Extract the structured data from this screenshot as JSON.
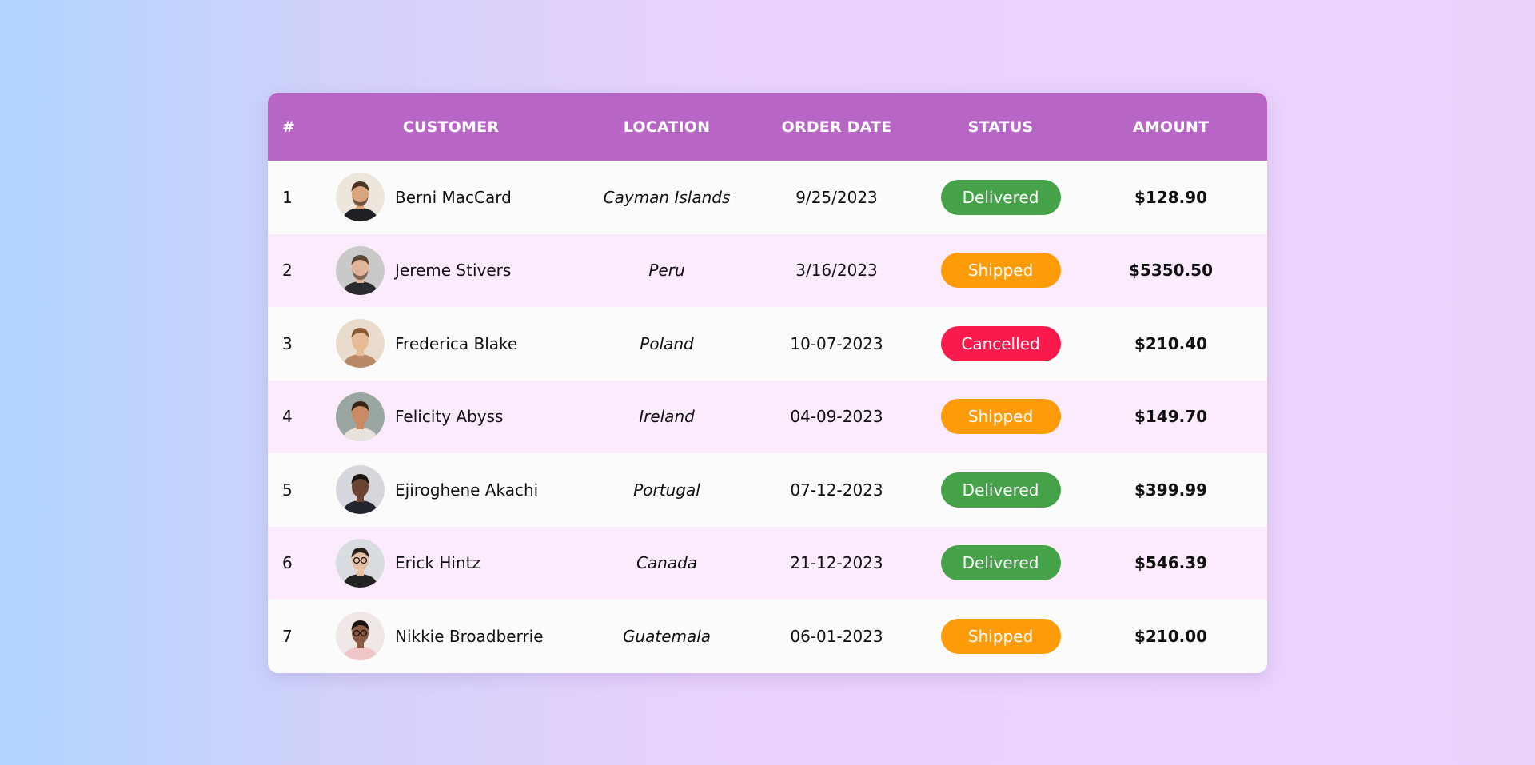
{
  "table": {
    "headers": {
      "num": "#",
      "customer": "CUSTOMER",
      "location": "LOCATION",
      "order_date": "ORDER DATE",
      "status": "STATUS",
      "amount": "AMOUNT"
    },
    "rows": [
      {
        "num": "1",
        "name": "Berni MacCard",
        "location": "Cayman Islands",
        "date": "9/25/2023",
        "status": "Delivered",
        "amount": "$128.90"
      },
      {
        "num": "2",
        "name": "Jereme Stivers",
        "location": "Peru",
        "date": "3/16/2023",
        "status": "Shipped",
        "amount": "$5350.50"
      },
      {
        "num": "3",
        "name": "Frederica Blake",
        "location": "Poland",
        "date": "10-07-2023",
        "status": "Cancelled",
        "amount": "$210.40"
      },
      {
        "num": "4",
        "name": "Felicity Abyss",
        "location": "Ireland",
        "date": "04-09-2023",
        "status": "Shipped",
        "amount": "$149.70"
      },
      {
        "num": "5",
        "name": "Ejiroghene Akachi",
        "location": "Portugal",
        "date": "07-12-2023",
        "status": "Delivered",
        "amount": "$399.99"
      },
      {
        "num": "6",
        "name": "Erick Hintz",
        "location": "Canada",
        "date": "21-12-2023",
        "status": "Delivered",
        "amount": "$546.39"
      },
      {
        "num": "7",
        "name": "Nikkie Broadberrie",
        "location": "Guatemala",
        "date": "06-01-2023",
        "status": "Shipped",
        "amount": "$210.00"
      }
    ]
  },
  "colors": {
    "header_bg": "#b866c6",
    "row_odd": "#fcfbfc",
    "row_even": "#fcebfd",
    "delivered": "#45a249",
    "shipped": "#fe9b09",
    "cancelled": "#fa1a4c"
  },
  "icons": {
    "avatar": "user-photo-avatar"
  }
}
